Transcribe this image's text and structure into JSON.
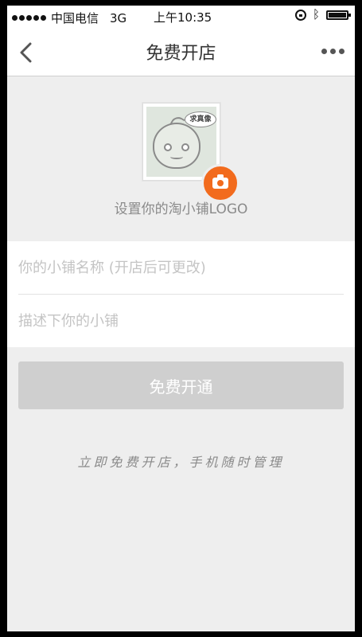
{
  "status_bar": {
    "carrier": "中国电信",
    "network": "3G",
    "time": "上午10:35"
  },
  "nav": {
    "title": "免费开店",
    "back_icon": "chevron-left-icon",
    "more_icon": "more-horizontal-icon"
  },
  "logo": {
    "bubble_text": "求真像",
    "caption": "设置你的淘小铺LOGO",
    "camera_color": "#f26b1d"
  },
  "form": {
    "name_placeholder": "你的小铺名称 (开店后可更改)",
    "desc_placeholder": "描述下你的小铺"
  },
  "submit": {
    "label": "免费开通",
    "color": "#cfcfcf"
  },
  "footer": {
    "text": "立即免费开店，手机随时管理"
  }
}
